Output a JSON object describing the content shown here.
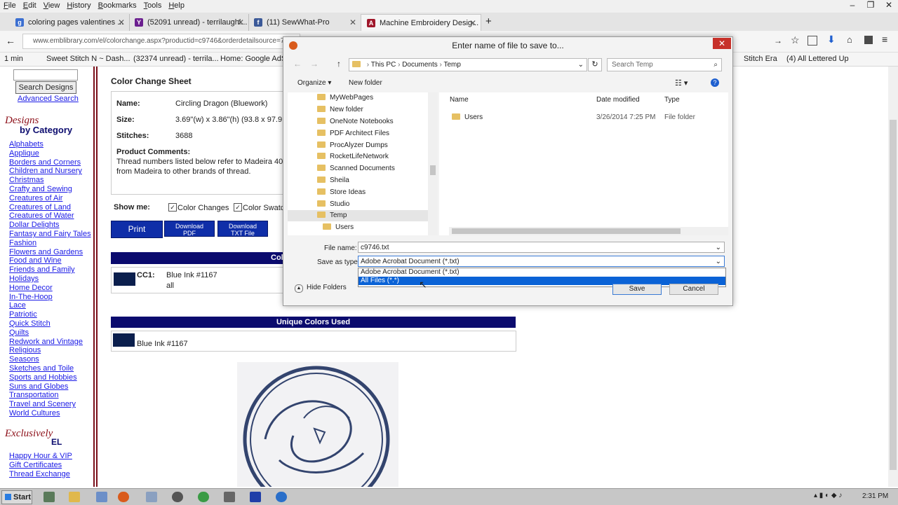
{
  "menu": [
    "File",
    "Edit",
    "View",
    "History",
    "Bookmarks",
    "Tools",
    "Help"
  ],
  "window_controls": {
    "minimize": "–",
    "restore": "❐",
    "close": "✕"
  },
  "tabs": [
    {
      "label": "coloring pages valentines ...",
      "color": "#3b6fd1",
      "glyph": "g"
    },
    {
      "label": "(52091 unread) - terrilaughl...",
      "color": "#6b1f8f",
      "glyph": "Y"
    },
    {
      "label": "(11) SewWhat-Pro",
      "color": "#3b5998",
      "glyph": "f"
    },
    {
      "label": "Machine Embroidery Desig...",
      "color": "#a0182b",
      "glyph": "A"
    }
  ],
  "url": "www.emblibrary.com/el/colorchange.aspx?productid=c9746&orderdetailsource=797",
  "bookmarks": [
    {
      "label": "1 min"
    },
    {
      "label": "Sweet Stitch N ~ Dash..."
    },
    {
      "label": "(32374 unread) - terrila..."
    },
    {
      "label": "Home: Google AdSer"
    },
    {
      "label": "Stitch Era"
    },
    {
      "label": "(4) All Lettered Up"
    }
  ],
  "sidebar": {
    "search_button": "Search Designs",
    "advanced_search": "Advanced Search",
    "designs_heading_1": "Designs",
    "designs_heading_2": "by Category",
    "categories": [
      "Alphabets",
      "Applique",
      "Borders and Corners",
      "Children and Nursery",
      "Christmas",
      "Crafty and Sewing",
      "Creatures of Air",
      "Creatures of Land",
      "Creatures of Water",
      "Dollar Delights",
      "Fantasy and Fairy Tales",
      "Fashion",
      "Flowers and Gardens",
      "Food and Wine",
      "Friends and Family",
      "Holidays",
      "Home Decor",
      "In-The-Hoop",
      "Lace",
      "Patriotic",
      "Quick Stitch",
      "Quilts",
      "Redwork and Vintage",
      "Religious",
      "Seasons",
      "Sketches and Toile",
      "Sports and Hobbies",
      "Suns and Globes",
      "Transportation",
      "Travel and Scenery",
      "World Cultures"
    ],
    "exclusively_1": "Exclusively",
    "exclusively_2": "EL",
    "extra_links": [
      "Happy Hour & VIP",
      "Gift Certificates",
      "Thread Exchange"
    ]
  },
  "sheet": {
    "title": "Color Change Sheet",
    "name_label": "Name:",
    "name_value": "Circling Dragon (Bluework)",
    "size_label": "Size:",
    "size_value": "3.69\"(w) x 3.86\"(h) (93.8 x 97.9 m",
    "stitches_label": "Stitches:",
    "stitches_value": "3688",
    "comments_label": "Product Comments:",
    "comments_line1": "Thread numbers listed below refer to Madeira 40 we",
    "comments_line2": "from Madeira to other brands of thread.",
    "show_me": "Show me:",
    "opt_color_changes": "Color Changes",
    "opt_color_swatches": "Color Swatc",
    "btn_print": "Print",
    "btn_pdf_1": "Download",
    "btn_pdf_2": "PDF",
    "btn_txt_1": "Download",
    "btn_txt_2": "TXT File",
    "color_bar_label": "Col",
    "cc_label": "CC1:",
    "cc_name": "Blue Ink #1167",
    "cc_sub": "all",
    "unique_header": "Unique Colors Used",
    "unique_color": "Blue Ink #1167",
    "swatch_color": "#0b1f4d"
  },
  "dialog": {
    "title": "Enter name of file to save to...",
    "breadcrumb": [
      "This PC",
      "Documents",
      "Temp"
    ],
    "search_placeholder": "Search Temp",
    "organize": "Organize",
    "new_folder": "New folder",
    "tree": [
      "MyWebPages",
      "New folder",
      "OneNote Notebooks",
      "PDF Architect Files",
      "ProcAlyzer Dumps",
      "RocketLifeNetwork",
      "Scanned Documents",
      "Sheila",
      "Store Ideas",
      "Studio",
      "Temp",
      "Users"
    ],
    "columns": {
      "name": "Name",
      "date": "Date modified",
      "type": "Type"
    },
    "files": [
      {
        "name": "Users",
        "date": "3/26/2014 7:25 PM",
        "type": "File folder"
      }
    ],
    "file_name_label": "File name:",
    "file_name_value": "c9746.txt",
    "save_type_label": "Save as type:",
    "save_type_value": "Adobe Acrobat Document (*.txt)",
    "dropdown_options": [
      "Adobe Acrobat Document (*.txt)",
      "All Files (*.*)"
    ],
    "hide_folders": "Hide Folders",
    "save": "Save",
    "cancel": "Cancel"
  },
  "taskbar": {
    "start": "Start",
    "time": "2:31 PM"
  }
}
